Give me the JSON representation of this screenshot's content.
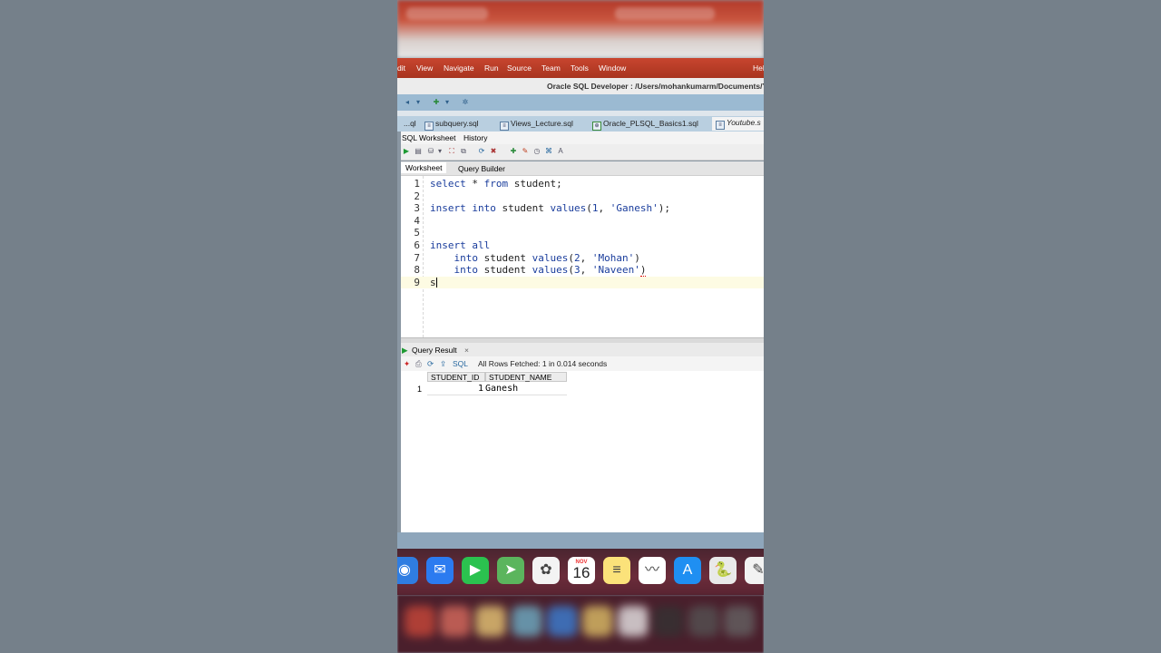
{
  "menubar": {
    "items": [
      "dit",
      "View",
      "Navigate",
      "Run",
      "Source",
      "Team",
      "Tools",
      "Window",
      "Hel"
    ]
  },
  "window": {
    "title": "Oracle SQL Developer : /Users/mohankumarm/Documents/Y"
  },
  "file_tabs": [
    {
      "label": "...ql",
      "icon": "sql-file-icon"
    },
    {
      "label": "subquery.sql",
      "icon": "sql-file-icon"
    },
    {
      "label": "Views_Lecture.sql",
      "icon": "sql-file-icon"
    },
    {
      "label": "Oracle_PLSQL_Basics1.sql",
      "icon": "connection-icon"
    },
    {
      "label": "Youtube.s",
      "icon": "sql-file-icon"
    }
  ],
  "sub_tabs": {
    "worksheet": "SQL Worksheet",
    "history": "History"
  },
  "worksheet_tabs": {
    "worksheet": "Worksheet",
    "query_builder": "Query Builder"
  },
  "editor": {
    "lines": [
      {
        "num": "1",
        "tokens": [
          [
            "kw",
            "select"
          ],
          [
            "p",
            " * "
          ],
          [
            "kw",
            "from"
          ],
          [
            "p",
            " student;"
          ]
        ]
      },
      {
        "num": "2",
        "tokens": []
      },
      {
        "num": "3",
        "tokens": [
          [
            "kw",
            "insert into"
          ],
          [
            "p",
            " student "
          ],
          [
            "kw",
            "values"
          ],
          [
            "p",
            "("
          ],
          [
            "nm",
            "1"
          ],
          [
            "p",
            ", "
          ],
          [
            "str",
            "'Ganesh'"
          ],
          [
            "p",
            ");"
          ]
        ]
      },
      {
        "num": "4",
        "tokens": []
      },
      {
        "num": "5",
        "tokens": []
      },
      {
        "num": "6",
        "tokens": [
          [
            "kw",
            "insert all"
          ]
        ]
      },
      {
        "num": "7",
        "tokens": [
          [
            "p",
            "    "
          ],
          [
            "kw",
            "into"
          ],
          [
            "p",
            " student "
          ],
          [
            "kw",
            "values"
          ],
          [
            "p",
            "("
          ],
          [
            "nm",
            "2"
          ],
          [
            "p",
            ", "
          ],
          [
            "str",
            "'Mohan'"
          ],
          [
            "p",
            ")"
          ]
        ]
      },
      {
        "num": "8",
        "tokens": [
          [
            "p",
            "    "
          ],
          [
            "kw",
            "into"
          ],
          [
            "p",
            " student "
          ],
          [
            "kw",
            "values"
          ],
          [
            "p",
            "("
          ],
          [
            "nm",
            "3"
          ],
          [
            "p",
            ", "
          ],
          [
            "str",
            "'Naveen'"
          ],
          [
            "sq",
            ")"
          ]
        ]
      },
      {
        "num": "9",
        "tokens": [
          [
            "p",
            "s"
          ]
        ]
      }
    ],
    "current_line": 9
  },
  "query_result": {
    "tab_label": "Query Result",
    "close_label": "×",
    "sql_link": "SQL",
    "status": "All Rows Fetched: 1 in 0.014 seconds",
    "columns": [
      "STUDENT_ID",
      "STUDENT_NAME"
    ],
    "rows": [
      {
        "row_num": "1",
        "cells": [
          "1",
          "Ganesh"
        ]
      }
    ]
  },
  "dock": {
    "apps": [
      {
        "name": "safari-icon",
        "glyph": "◉",
        "color": "#2f7de1"
      },
      {
        "name": "mail-icon",
        "glyph": "✉",
        "color": "#2b7bf0"
      },
      {
        "name": "facetime-icon",
        "glyph": "▶",
        "color": "#2bc24f"
      },
      {
        "name": "maps-icon",
        "glyph": "➤",
        "color": "#5bb55d"
      },
      {
        "name": "photos-icon",
        "glyph": "✿",
        "color": "#f3f3f3"
      },
      {
        "name": "calendar-icon",
        "glyph": "16",
        "color": "#ffffff"
      },
      {
        "name": "notes-icon",
        "glyph": "≡",
        "color": "#fbe27a"
      },
      {
        "name": "freeform-icon",
        "glyph": "〰",
        "color": "#ffffff"
      },
      {
        "name": "app-store-icon",
        "glyph": "A",
        "color": "#1f8ff2"
      },
      {
        "name": "python-icon",
        "glyph": "🐍",
        "color": "#e9e9e9"
      },
      {
        "name": "textedit-icon",
        "glyph": "✎",
        "color": "#f2f2f2"
      }
    ],
    "calendar_month": "NOV",
    "calendar_day": "16"
  }
}
